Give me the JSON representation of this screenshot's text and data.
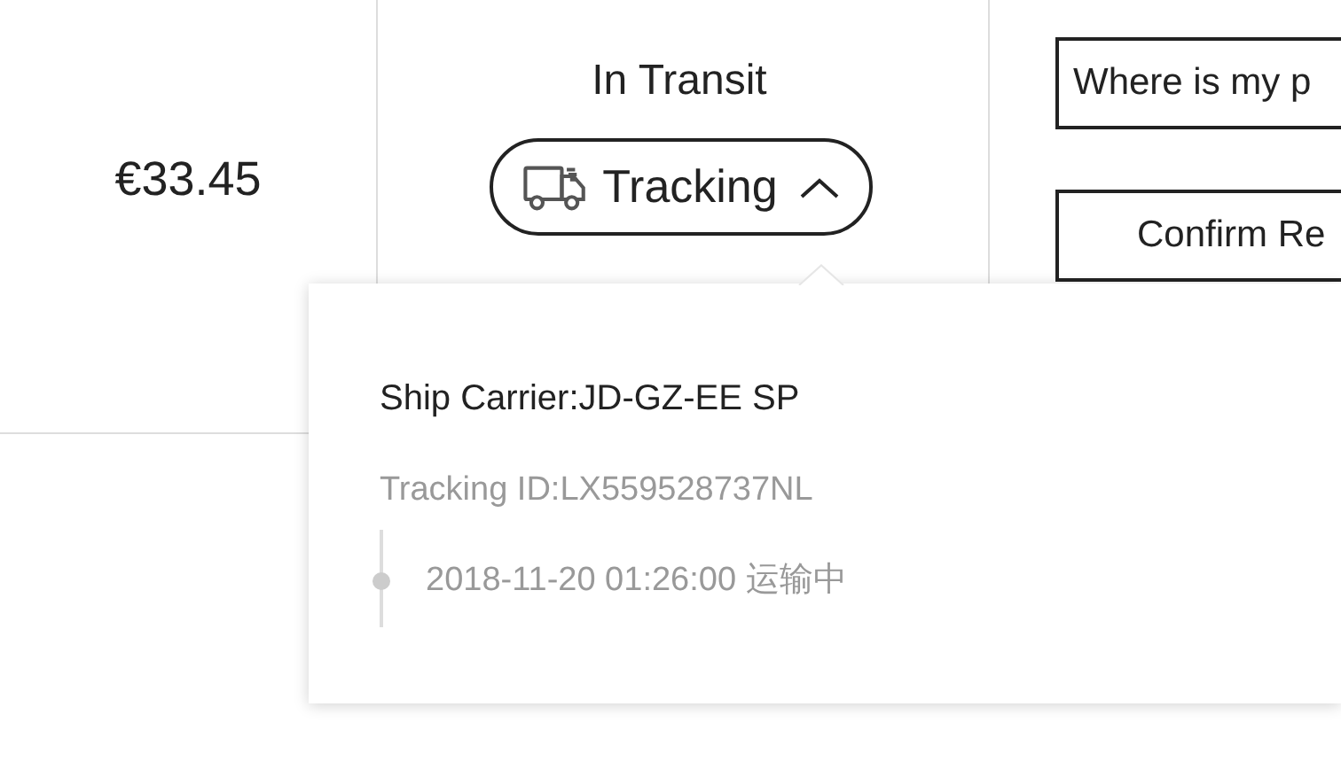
{
  "order": {
    "price": "€33.45",
    "status": "In Transit",
    "tracking_button": {
      "label": "Tracking",
      "expanded": true
    },
    "actions": [
      "Where is my p",
      "Confirm Re"
    ]
  },
  "tracking_popover": {
    "carrier": "Ship Carrier:JD-GZ-EE SP",
    "tracking_id": "Tracking ID:LX559528737NL",
    "events": [
      {
        "text": "2018-11-20 01:26:00 运输中"
      }
    ]
  }
}
